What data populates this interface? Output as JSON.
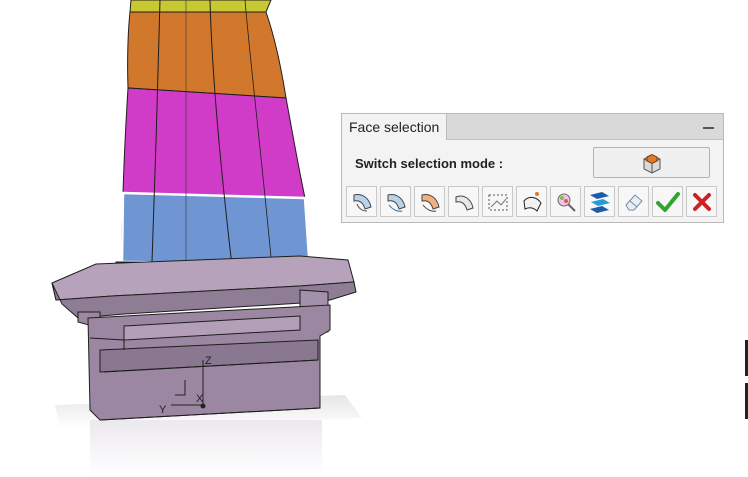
{
  "panel": {
    "title": "Face selection",
    "mode_label": "Switch selection mode :",
    "mode_button_icon": "solid-part-icon"
  },
  "toolbar": {
    "tools": [
      {
        "icon": "propagate-face-icon"
      },
      {
        "icon": "propagate-tangent-icon"
      },
      {
        "icon": "propagate-curvature-icon"
      },
      {
        "icon": "single-face-icon"
      },
      {
        "icon": "box-select-icon"
      },
      {
        "icon": "face-pick-icon"
      },
      {
        "icon": "color-select-icon"
      },
      {
        "icon": "layer-faces-icon"
      },
      {
        "icon": "eraser-icon"
      },
      {
        "icon": "confirm-check-icon"
      },
      {
        "icon": "cancel-x-icon"
      }
    ]
  },
  "axes": {
    "x_label": "X",
    "y_label": "Y",
    "z_label": "Z"
  },
  "colors": {
    "yellow_band": "#c8c832",
    "orange_band": "#d2782d",
    "magenta_band": "#d03cc8",
    "selected_band": "#6f95d3",
    "root": "#9f8aa5",
    "check": "#2ea52e",
    "cross": "#cc2222"
  }
}
